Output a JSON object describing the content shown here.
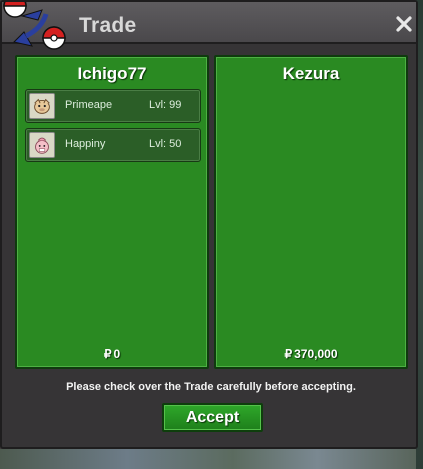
{
  "window": {
    "title": "Trade",
    "close_icon": "close-icon",
    "logo_icon": "pokeball-logo-icon"
  },
  "left_panel": {
    "trainer": "Ichigo77",
    "currency_symbol": "₽",
    "money": "0",
    "pokemon": [
      {
        "name": "Primeape",
        "level": "Lvl: 99",
        "icon": "primeape-sprite-icon"
      },
      {
        "name": "Happiny",
        "level": "Lvl: 50",
        "icon": "happiny-sprite-icon"
      }
    ]
  },
  "right_panel": {
    "trainer": "Kezura",
    "currency_symbol": "₽",
    "money": "370,000",
    "pokemon": []
  },
  "notice": "Please check over the Trade carefully before accepting.",
  "accept_label": "Accept",
  "colors": {
    "panel_green": "#2a8a22",
    "accept_green": "#2fa82a",
    "window_bg": "#363436",
    "titlebar": "#4a484b"
  }
}
